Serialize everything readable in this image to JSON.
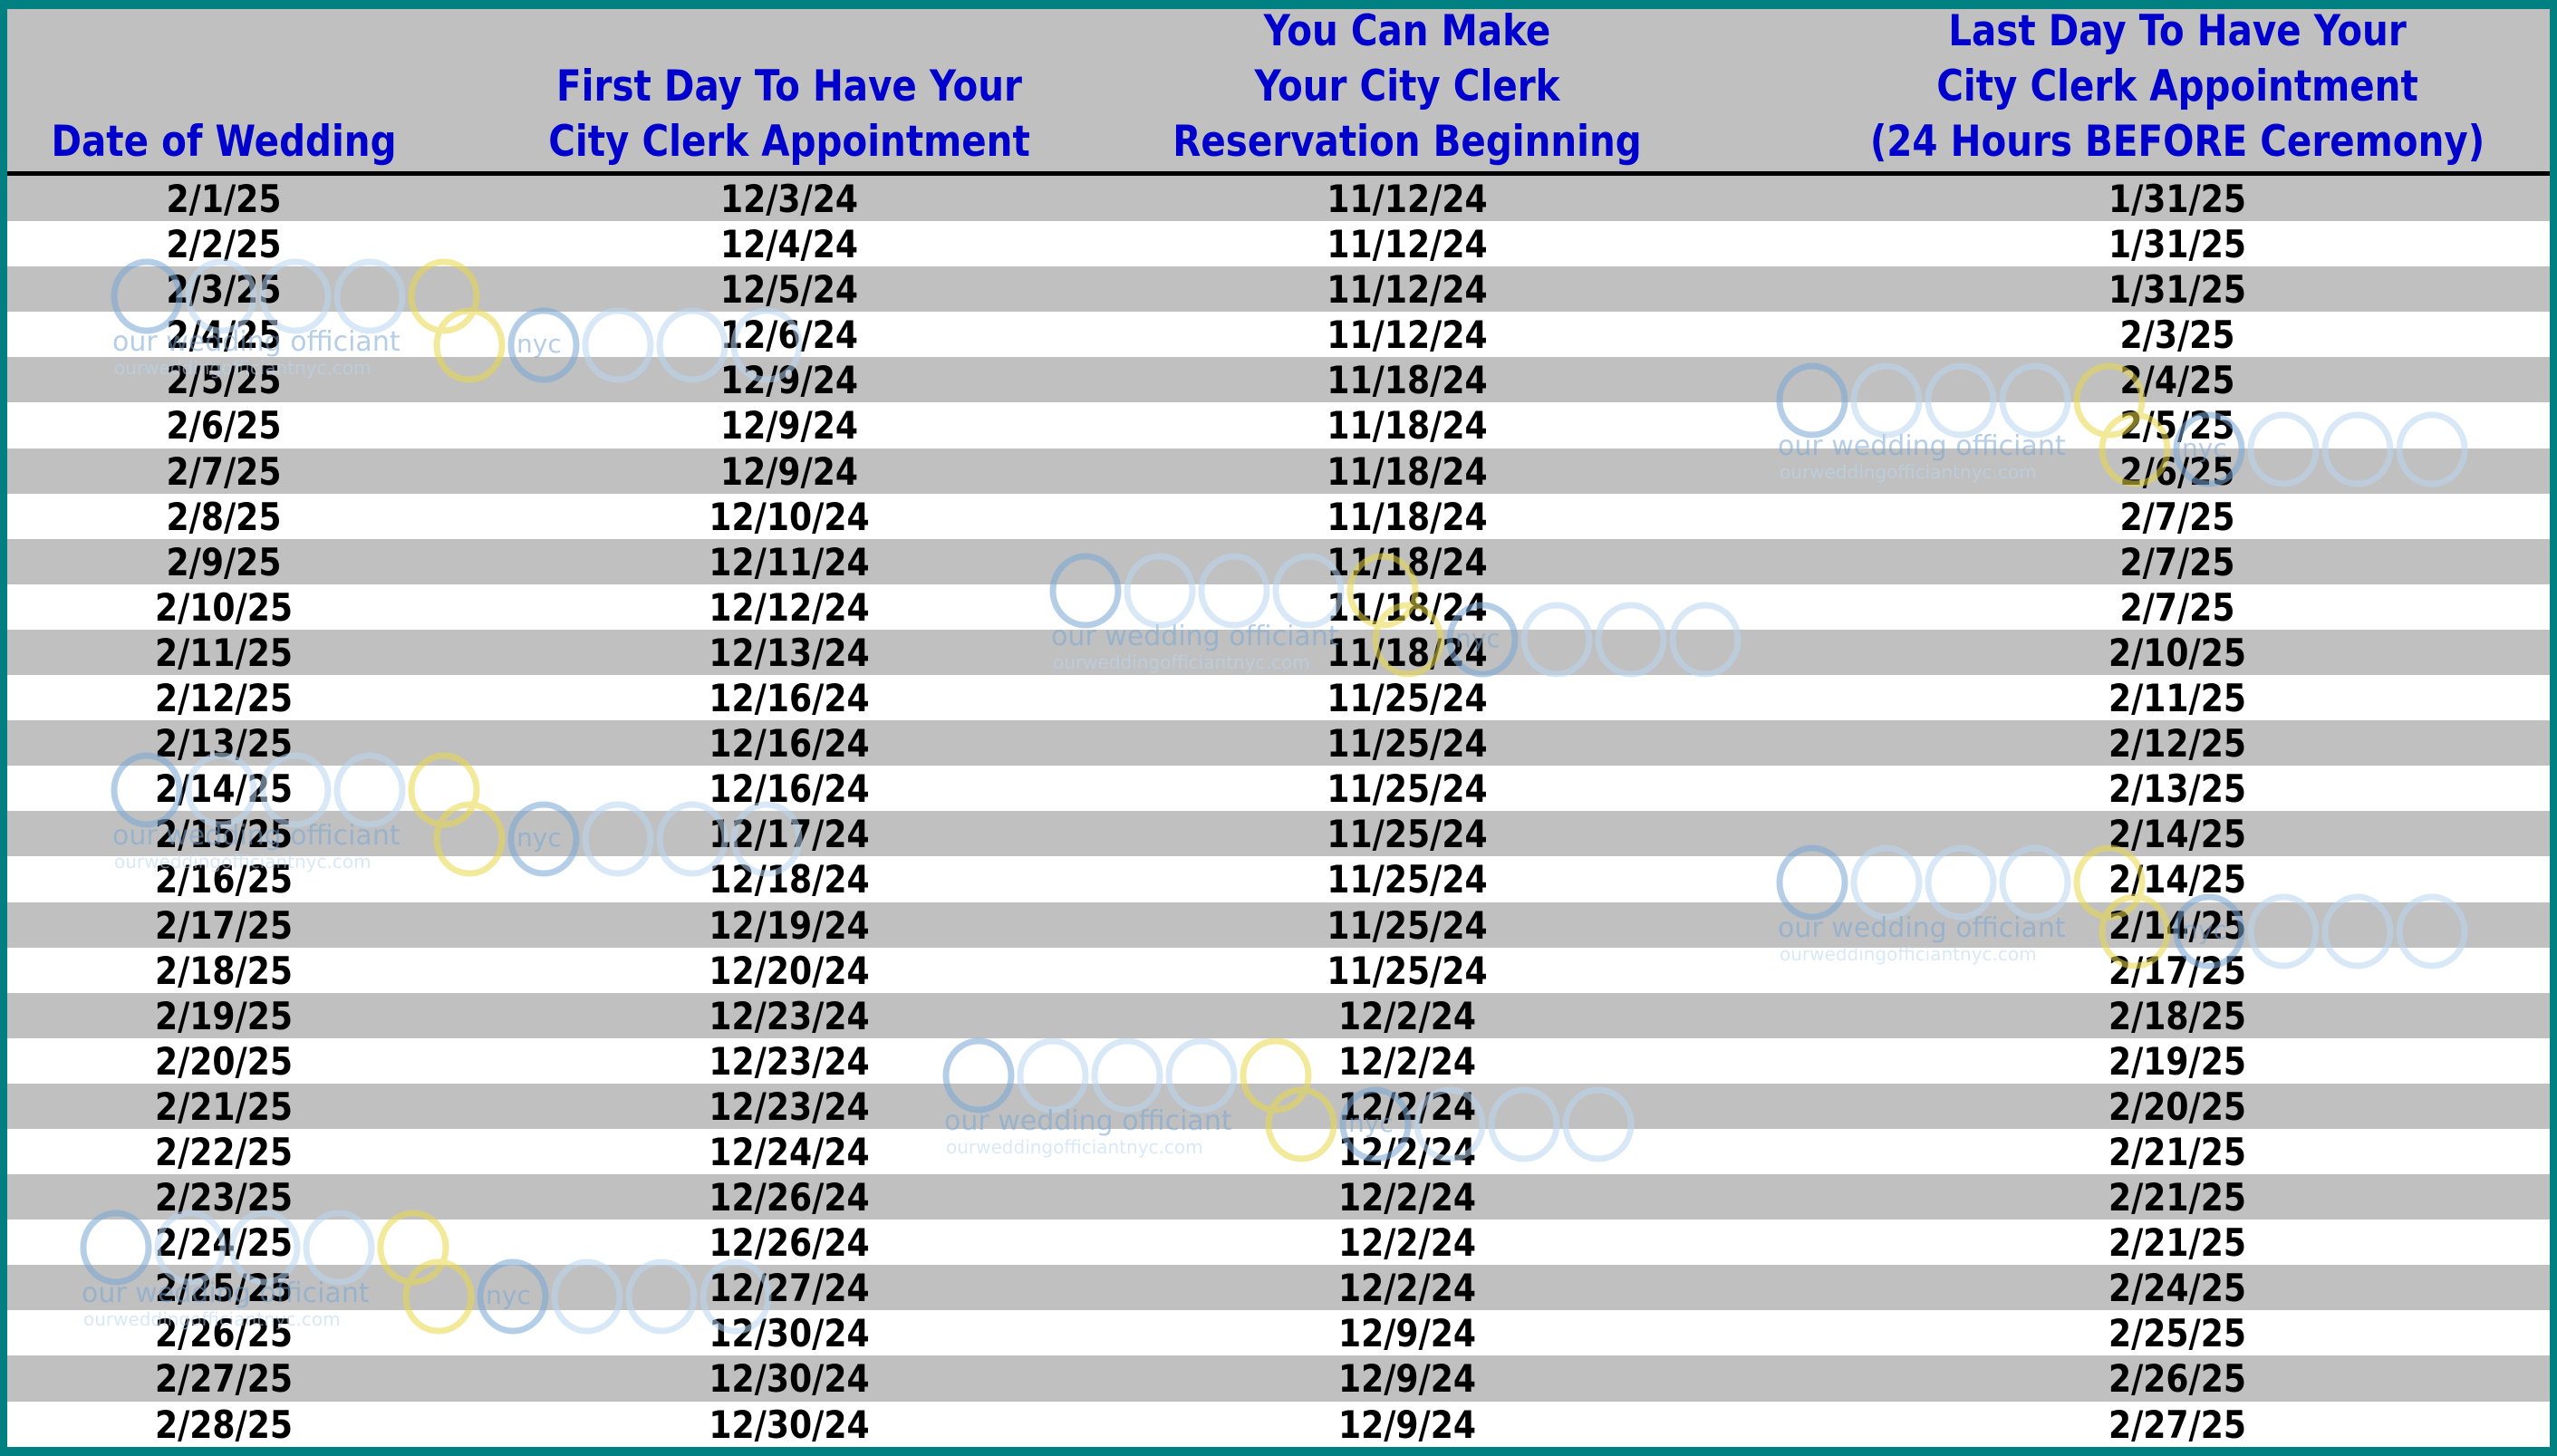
{
  "table": {
    "headers": [
      "Date of Wedding",
      "First Day To Have Your\nCity Clerk Appointment",
      "You Can Make\nYour City Clerk\nReservation Beginning",
      "Last Day To Have Your\nCity Clerk Appointment\n(24 Hours BEFORE Ceremony)"
    ],
    "rows": [
      [
        "2/1/25",
        "12/3/24",
        "11/12/24",
        "1/31/25"
      ],
      [
        "2/2/25",
        "12/4/24",
        "11/12/24",
        "1/31/25"
      ],
      [
        "2/3/25",
        "12/5/24",
        "11/12/24",
        "1/31/25"
      ],
      [
        "2/4/25",
        "12/6/24",
        "11/12/24",
        "2/3/25"
      ],
      [
        "2/5/25",
        "12/9/24",
        "11/18/24",
        "2/4/25"
      ],
      [
        "2/6/25",
        "12/9/24",
        "11/18/24",
        "2/5/25"
      ],
      [
        "2/7/25",
        "12/9/24",
        "11/18/24",
        "2/6/25"
      ],
      [
        "2/8/25",
        "12/10/24",
        "11/18/24",
        "2/7/25"
      ],
      [
        "2/9/25",
        "12/11/24",
        "11/18/24",
        "2/7/25"
      ],
      [
        "2/10/25",
        "12/12/24",
        "11/18/24",
        "2/7/25"
      ],
      [
        "2/11/25",
        "12/13/24",
        "11/18/24",
        "2/10/25"
      ],
      [
        "2/12/25",
        "12/16/24",
        "11/25/24",
        "2/11/25"
      ],
      [
        "2/13/25",
        "12/16/24",
        "11/25/24",
        "2/12/25"
      ],
      [
        "2/14/25",
        "12/16/24",
        "11/25/24",
        "2/13/25"
      ],
      [
        "2/15/25",
        "12/17/24",
        "11/25/24",
        "2/14/25"
      ],
      [
        "2/16/25",
        "12/18/24",
        "11/25/24",
        "2/14/25"
      ],
      [
        "2/17/25",
        "12/19/24",
        "11/25/24",
        "2/14/25"
      ],
      [
        "2/18/25",
        "12/20/24",
        "11/25/24",
        "2/17/25"
      ],
      [
        "2/19/25",
        "12/23/24",
        "12/2/24",
        "2/18/25"
      ],
      [
        "2/20/25",
        "12/23/24",
        "12/2/24",
        "2/19/25"
      ],
      [
        "2/21/25",
        "12/23/24",
        "12/2/24",
        "2/20/25"
      ],
      [
        "2/22/25",
        "12/24/24",
        "12/2/24",
        "2/21/25"
      ],
      [
        "2/23/25",
        "12/26/24",
        "12/2/24",
        "2/21/25"
      ],
      [
        "2/24/25",
        "12/26/24",
        "12/2/24",
        "2/21/25"
      ],
      [
        "2/25/25",
        "12/27/24",
        "12/2/24",
        "2/24/25"
      ],
      [
        "2/26/25",
        "12/30/24",
        "12/9/24",
        "2/25/25"
      ],
      [
        "2/27/25",
        "12/30/24",
        "12/9/24",
        "2/26/25"
      ],
      [
        "2/28/25",
        "12/30/24",
        "12/9/24",
        "2/27/25"
      ]
    ]
  },
  "watermark": {
    "name": "our wedding officiant",
    "suffix": "nyc",
    "url": "ourweddingofficiantnyc.com",
    "ring_blue": "#7aa7d6",
    "ring_light": "#b9d6f2",
    "ring_yellow": "#e8d84a"
  },
  "colors": {
    "border": "#008080",
    "header_text": "#0000cc",
    "row_shaded": "#c0c0c0",
    "row_plain": "#ffffff"
  }
}
